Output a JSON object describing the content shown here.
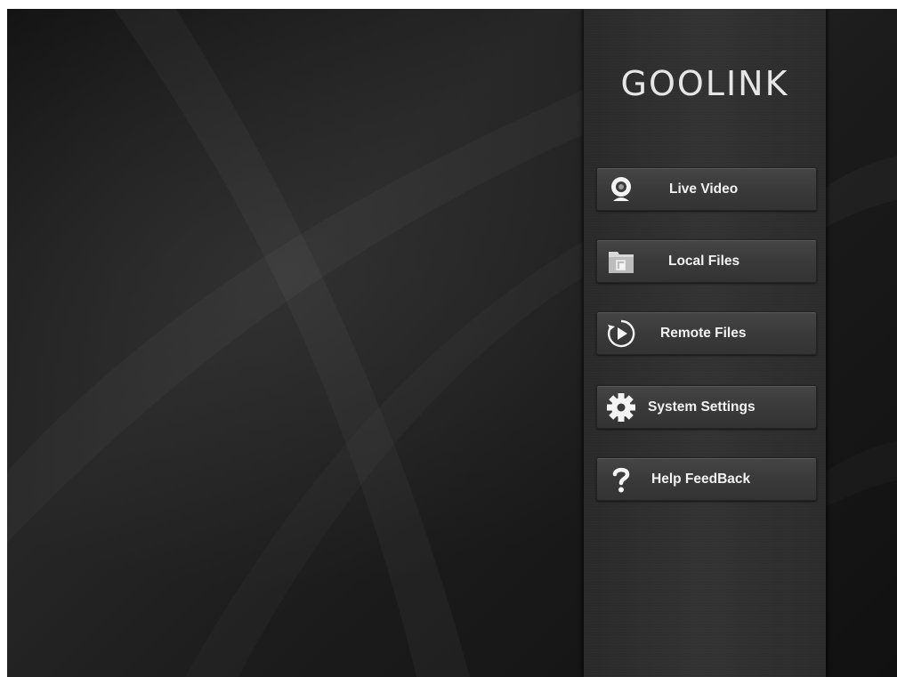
{
  "brand": {
    "name": "GOOLINK"
  },
  "menu": {
    "items": [
      {
        "label": "Live Video",
        "icon": "webcam-icon"
      },
      {
        "label": "Local Files",
        "icon": "folder-icon"
      },
      {
        "label": "Remote Files",
        "icon": "replay-icon"
      },
      {
        "label": "System Settings",
        "icon": "gear-icon"
      },
      {
        "label": "Help FeedBack",
        "icon": "question-icon"
      }
    ]
  },
  "colors": {
    "background": "#1b1b1b",
    "panel": "#303030",
    "button": "#3c3c3c",
    "text": "#f2f2f2"
  }
}
